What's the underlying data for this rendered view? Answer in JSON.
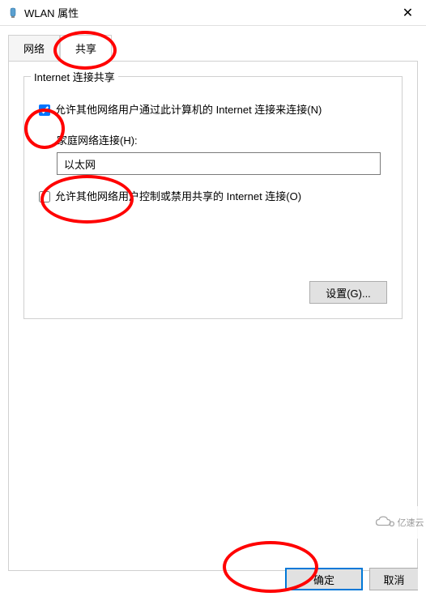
{
  "titlebar": {
    "title": "WLAN 属性",
    "close": "✕"
  },
  "tabs": {
    "network": "网络",
    "sharing": "共享"
  },
  "groupbox": {
    "title": "Internet 连接共享"
  },
  "checkboxes": {
    "allow_connect": "允许其他网络用户通过此计算机的 Internet 连接来连接(N)",
    "allow_control": "允许其他网络用户控制或禁用共享的 Internet 连接(O)"
  },
  "home_network": {
    "label": "家庭网络连接(H):",
    "selected": "以太网"
  },
  "buttons": {
    "settings": "设置(G)...",
    "ok": "确定",
    "cancel": "取消"
  },
  "watermark": "亿速云"
}
